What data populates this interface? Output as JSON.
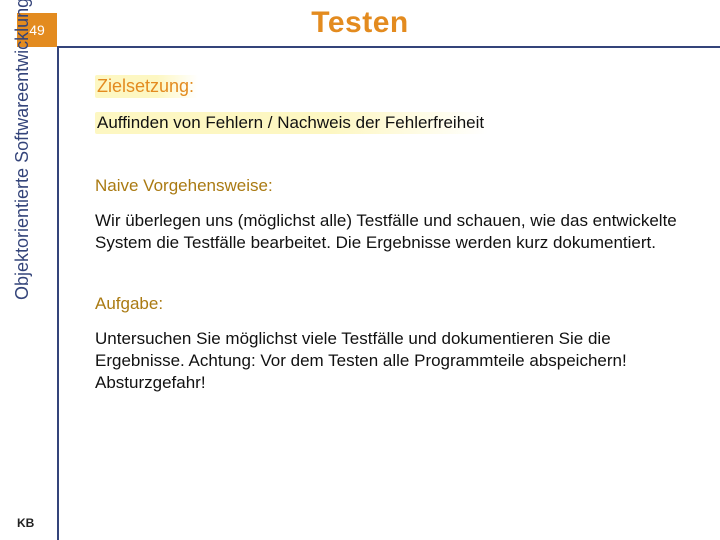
{
  "page_number": "49",
  "title": "Testen",
  "side_label": "Objektorientierte Softwareentwicklung",
  "footer": "KB",
  "sections": {
    "zielsetzung_label": "Zielsetzung:",
    "zielsetzung_text": "Auffinden von Fehlern / Nachweis der Fehlerfreiheit",
    "naive_label": "Naive Vorgehensweise:",
    "naive_text": "Wir überlegen uns (möglichst alle) Testfälle und schauen, wie das entwickelte System die Testfälle bearbeitet. Die Ergebnisse werden kurz dokumentiert.",
    "aufgabe_label": "Aufgabe:",
    "aufgabe_text": "Untersuchen Sie möglichst viele Testfälle und dokumentieren Sie die Ergebnisse. Achtung: Vor dem Testen alle Programmteile abspeichern! Absturzgefahr!"
  },
  "colors": {
    "accent_orange": "#e38b1f",
    "accent_blue": "#34447a",
    "highlight_yellow": "#fdf7c2",
    "subhead_brown": "#aa7a12"
  }
}
